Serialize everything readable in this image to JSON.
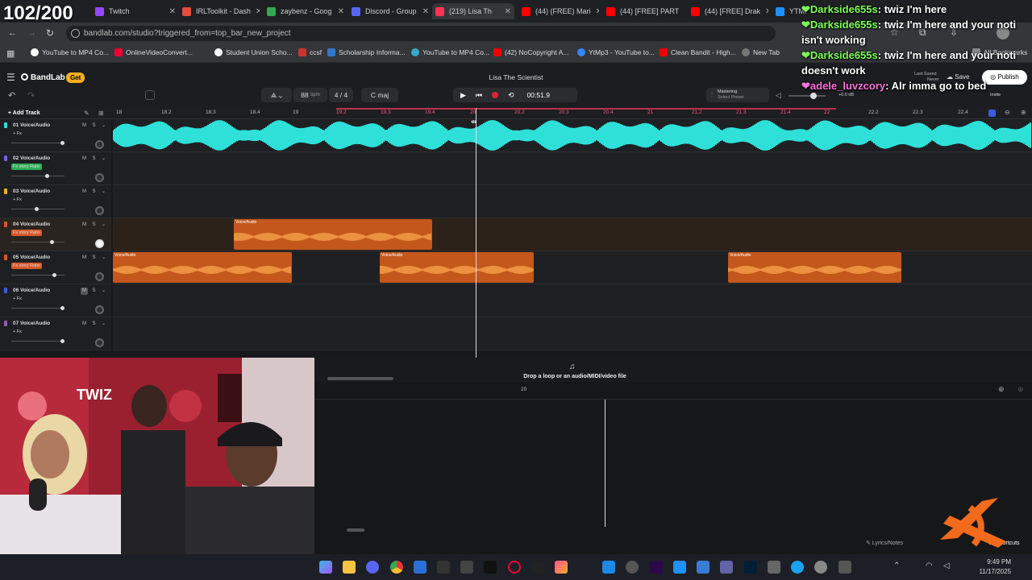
{
  "overlay": {
    "counter": "102/200"
  },
  "browser": {
    "tabs": [
      {
        "title": "Twitch",
        "color": "#9147ff"
      },
      {
        "title": "IRLToolkit - Dash",
        "color": "#e74c3c"
      },
      {
        "title": "zaybenz - Goog",
        "color": "#34a853"
      },
      {
        "title": "Discord - Group",
        "color": "#5865f2"
      },
      {
        "title": "(219) Lisa Th",
        "color": "#ff3355"
      },
      {
        "title": "(44) (FREE) Mari",
        "color": "#ff0000"
      },
      {
        "title": "(44) [FREE] PART",
        "color": "#ff0000"
      },
      {
        "title": "(44) [FREE] Drak",
        "color": "#ff0000"
      },
      {
        "title": "YTMP3",
        "color": "#1e90ff"
      }
    ],
    "url": "bandlab.com/studio?triggered_from=top_bar_new_project",
    "bookmarks": [
      "YouTube to MP4 Co...",
      "OnlineVideoConvert...",
      "Student Union Scho...",
      "ccsf",
      "Scholarship Informa...",
      "YouTube to MP4 Co...",
      "(42) NoCopyright A...",
      "YtMp3 - YouTube to...",
      "Clean Bandit - High...",
      "New Tab",
      "All Bookmarks"
    ]
  },
  "bandlab": {
    "logo": "BandLab",
    "get_badge": "Get",
    "project_title": "Lisa The Scientist",
    "bpm": "88",
    "bpm_unit": "bpm",
    "time_sig": "4 / 4",
    "key": "C maj",
    "time": "00:51.9",
    "mastering_label": "Mastering",
    "mastering_preset": "Select Preset",
    "volume_db": "+0.0 dB",
    "last_saved": "Last Saved",
    "last_saved_value": "Never",
    "save_label": "Save",
    "publish_label": "Publish",
    "invite_label": "Invite",
    "add_track_label": "Add Track",
    "ruler_ticks": [
      "18",
      "18.2",
      "18.3",
      "18.4",
      "19",
      "19.2",
      "19.3",
      "19.4",
      "20",
      "20.2",
      "20.3",
      "20.4",
      "21",
      "21.2",
      "21.3",
      "21.4",
      "22",
      "22.2",
      "22.3",
      "22.4"
    ],
    "tracks": [
      {
        "name": "01 Voice/Audio",
        "fx": "+ Fx",
        "fx_color": "",
        "vol": 0.95
      },
      {
        "name": "02 Voice/Audio",
        "fx": "Fx story Ratio",
        "fx_color": "#2fae59",
        "vol": 0.65
      },
      {
        "name": "03 Voice/Audio",
        "fx": "+ Fx",
        "fx_color": "",
        "vol": 0.45
      },
      {
        "name": "04 Voice/Audio",
        "fx": "Fx story Ratio",
        "fx_color": "#d8582a",
        "vol": 0.75
      },
      {
        "name": "05 Voice/Audio",
        "fx": "Fx story Ratio",
        "fx_color": "#d8582a",
        "vol": 0.8
      },
      {
        "name": "06 Voice/Audio",
        "fx": "+ Fx",
        "fx_color": "",
        "vol": 0.95
      },
      {
        "name": "07 Voice/Audio",
        "fx": "+ Fx",
        "fx_color": "",
        "vol": 0.95
      }
    ],
    "clip_label": "Voice/Audio",
    "drop_hint": "Drop a loop or an audio/MIDI/video file",
    "bottom_ruler": "20",
    "lyrics_label": "Lyrics/Notes",
    "shortcuts_label": "Shortcuts",
    "mute": "M",
    "solo": "S"
  },
  "webcam": {
    "wall_text": "TWIZ"
  },
  "chat": [
    {
      "user": "Darkside655s",
      "msg": "twiz I'm here",
      "color": "#7dff5a"
    },
    {
      "user": "Darkside655s",
      "msg": "twiz I'm here and your noti isn't working",
      "color": "#7dff5a"
    },
    {
      "user": "Darkside655s",
      "msg": "twiz I'm here and your noti doesn't work",
      "color": "#7dff5a"
    },
    {
      "user": "adele_luvzcory",
      "msg": "Alr imma go to bed",
      "color": "#ff6fd8"
    }
  ],
  "taskbar": {
    "time": "9:49 PM",
    "date": "11/17/2025"
  }
}
